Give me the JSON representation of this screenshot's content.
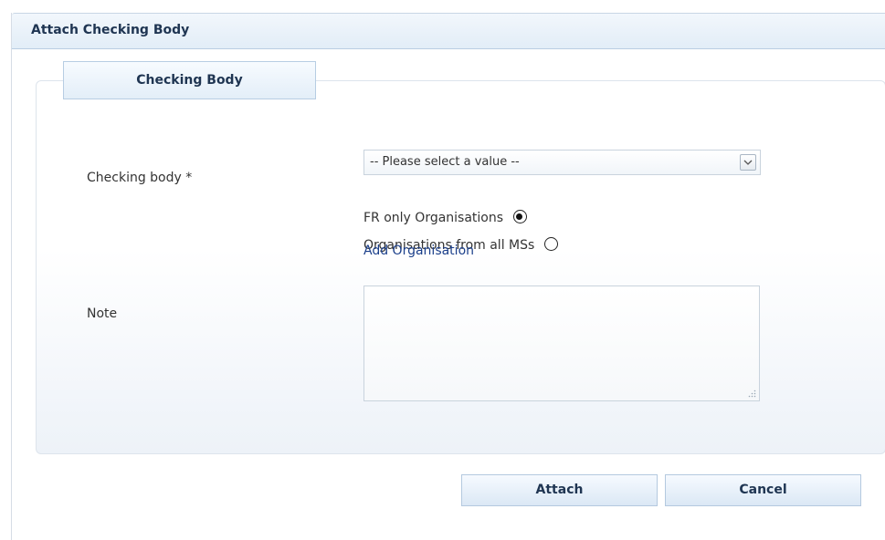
{
  "dialog": {
    "title": "Attach Checking Body"
  },
  "tab": {
    "label": "Checking Body"
  },
  "form": {
    "checking_body_label": "Checking body *",
    "checking_body_select": {
      "value": "-- Please select a value --"
    },
    "radio_options": [
      {
        "label": "FR only Organisations",
        "checked": true
      },
      {
        "label": "Organisations from all MSs",
        "checked": false
      }
    ],
    "add_organisation_link": "Add Organisation",
    "note_label": "Note",
    "note_value": ""
  },
  "buttons": {
    "attach": "Attach",
    "cancel": "Cancel"
  },
  "icons": {
    "select_arrow": "chevron-down-icon",
    "textarea_resize": "resize-grip-icon"
  }
}
